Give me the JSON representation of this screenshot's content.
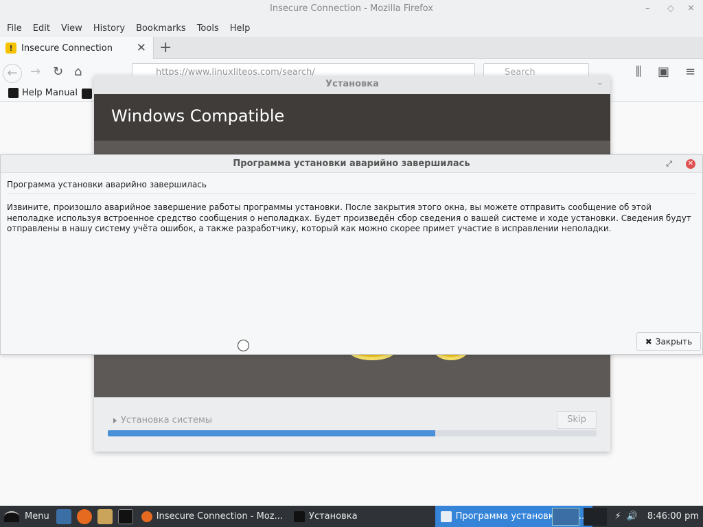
{
  "firefox": {
    "window_title": "Insecure Connection - Mozilla Firefox",
    "menu": [
      "File",
      "Edit",
      "View",
      "History",
      "Bookmarks",
      "Tools",
      "Help"
    ],
    "tab_title": "Insecure Connection",
    "url": "https://www.linuxliteos.com/search/",
    "search_placeholder": "Search",
    "bookmark": "Help Manual"
  },
  "installer": {
    "title": "Установка",
    "header": "Windows Compatible",
    "stage": "Установка системы",
    "skip": "Skip",
    "progress_fraction": 0.67
  },
  "dialog": {
    "title": "Программа установки аварийно завершилась",
    "heading": "Программа установки аварийно завершилась",
    "body": "Извините, произошло аварийное завершение работы программы установки. После закрытия этого окна, вы можете отправить сообщение об этой неполадке используя встроенное средство сообщения о неполадках. Будет произведён сбор сведения о вашей системе и ходе установки. Сведения будут отправлены в нашу систему учёта ошибок, а также разработчику, который как можно скорее примет участие в исправлении неполадки.",
    "close_button": "Закрыть"
  },
  "taskbar": {
    "menu_label": "Menu",
    "tasks": [
      "Insecure Connection - Moz...",
      "Установка",
      "Программа установки ава..."
    ],
    "clock": "8:46:00 pm"
  }
}
